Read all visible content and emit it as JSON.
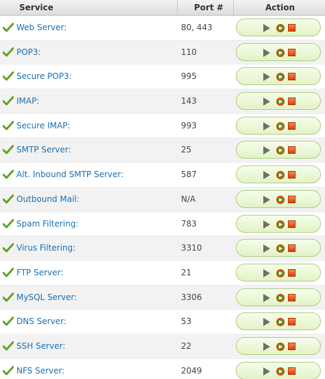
{
  "header": {
    "service": "Service",
    "port": "Port #",
    "action": "Action"
  },
  "colors": {
    "link": "#1a6fb2",
    "check": "#5fa31f",
    "action_bg": "#e2f3c6",
    "stop": "#d7410f"
  },
  "icons": {
    "status": "check-icon",
    "start": "play-icon",
    "restart": "restart-icon",
    "stop": "stop-icon"
  },
  "services": [
    {
      "name": "Web Server:",
      "port": "80, 443"
    },
    {
      "name": "POP3:",
      "port": "110"
    },
    {
      "name": "Secure POP3:",
      "port": "995"
    },
    {
      "name": "IMAP:",
      "port": "143"
    },
    {
      "name": "Secure IMAP:",
      "port": "993"
    },
    {
      "name": "SMTP Server:",
      "port": "25"
    },
    {
      "name": "Alt. Inbound SMTP Server:",
      "port": "587"
    },
    {
      "name": "Outbound Mail:",
      "port": "N/A"
    },
    {
      "name": "Spam Filtering:",
      "port": "783"
    },
    {
      "name": "Virus Filtering:",
      "port": "3310"
    },
    {
      "name": "FTP Server:",
      "port": "21"
    },
    {
      "name": "MySQL Server:",
      "port": "3306"
    },
    {
      "name": "DNS Server:",
      "port": "53"
    },
    {
      "name": "SSH Server:",
      "port": "22"
    },
    {
      "name": "NFS Server:",
      "port": "2049"
    }
  ]
}
